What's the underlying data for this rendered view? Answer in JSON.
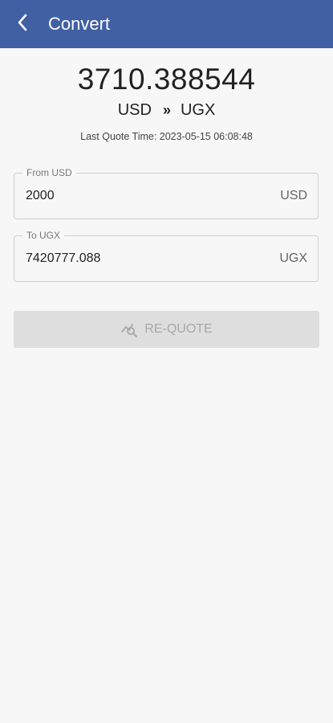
{
  "header": {
    "title": "Convert",
    "back_icon": "chevron-left-icon",
    "background_color": "#4060a3"
  },
  "rate": {
    "value": "3710.388544",
    "from_currency": "USD",
    "separator": "»",
    "to_currency": "UGX"
  },
  "quote_time": "Last Quote Time: 2023-05-15 06:08:48",
  "from_field": {
    "label": "From USD",
    "value": "2000",
    "unit": "USD"
  },
  "to_field": {
    "label": "To UGX",
    "value": "7420777.088",
    "unit": "UGX"
  },
  "requote_button": {
    "label": "RE-QUOTE",
    "icon": "chart-search-icon",
    "state": "disabled"
  }
}
